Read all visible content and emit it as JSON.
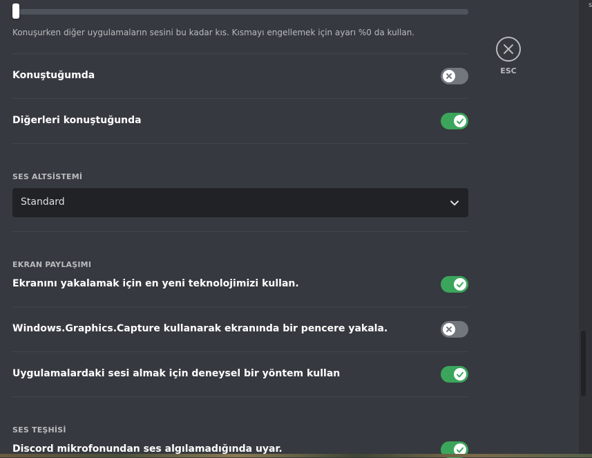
{
  "slider": {
    "value_percent": 0
  },
  "ducking_note": "Konuşurken diğer uygulamaların sesini bu kadar kıs. Kısmayı engellemek için ayarı %0 da kullan.",
  "ducking_rows": [
    {
      "label": "Konuştuğumda",
      "state": "off"
    },
    {
      "label": "Diğerleri konuştuğunda",
      "state": "on"
    }
  ],
  "audio_subsystem": {
    "title": "SES ALTSİSTEMİ",
    "selected": "Standard"
  },
  "screen_share": {
    "title": "EKRAN PAYLAŞIMI",
    "rows": [
      {
        "label": "Ekranını yakalamak için en yeni teknolojimizi kullan.",
        "state": "on"
      },
      {
        "label": "Windows.Graphics.Capture kullanarak ekranında bir pencere yakala.",
        "state": "off"
      },
      {
        "label": "Uygulamalardaki sesi almak için deneysel bir yöntem kullan",
        "state": "on"
      }
    ]
  },
  "voice_diagnostics": {
    "title": "SES TEŞHİSİ",
    "rows": [
      {
        "label": "Discord mikrofonundan ses algılamadığında uyar.",
        "state": "on"
      }
    ]
  },
  "close": {
    "label": "ESC",
    "icon": "close-icon"
  },
  "colors": {
    "toggle_on": "#3ba55c",
    "toggle_off": "#72767d",
    "background": "#36393f"
  },
  "edge_char": "s"
}
